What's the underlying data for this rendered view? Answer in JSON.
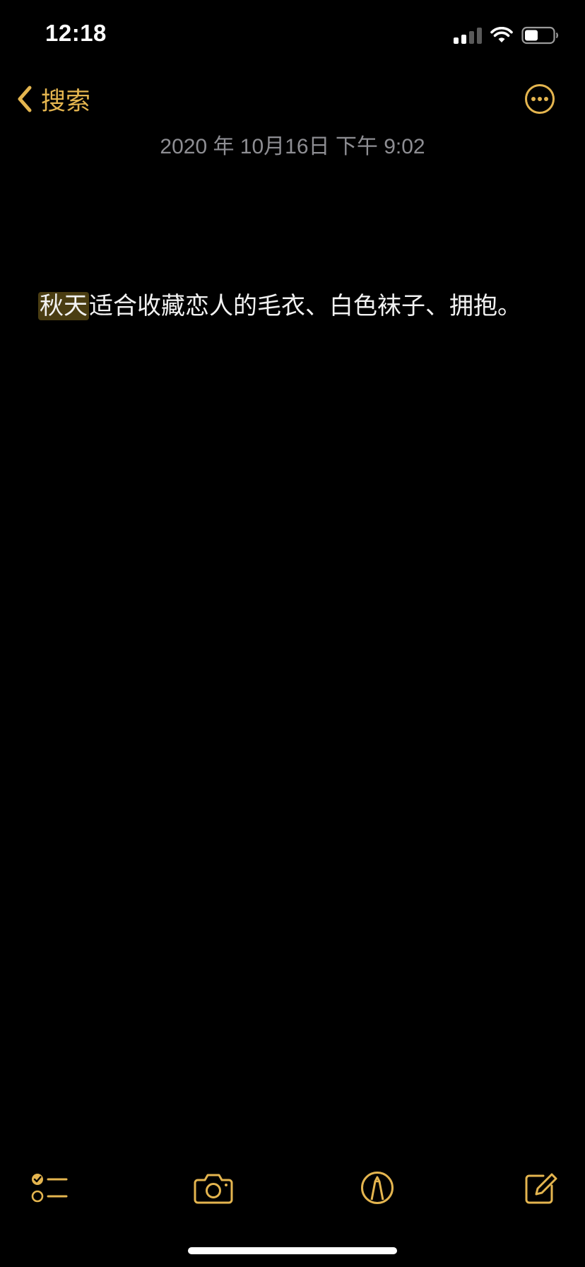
{
  "status_bar": {
    "time": "12:18"
  },
  "nav": {
    "back_label": "搜索",
    "back_icon": "chevron-left-icon",
    "more_icon": "ellipsis-circle-icon"
  },
  "note": {
    "date": "2020 年 10月16日 下午 9:02",
    "highlighted_text": "秋天",
    "body_rest": "适合收藏恋人的毛衣、白色袜子、拥抱。"
  },
  "toolbar": {
    "items": [
      {
        "icon": "checklist-icon"
      },
      {
        "icon": "camera-icon"
      },
      {
        "icon": "markup-pen-icon"
      },
      {
        "icon": "compose-icon"
      }
    ]
  },
  "colors": {
    "accent": "#e4b54f",
    "background": "#000000",
    "date_text": "#8e8e93",
    "highlight": "#4a3d12"
  }
}
